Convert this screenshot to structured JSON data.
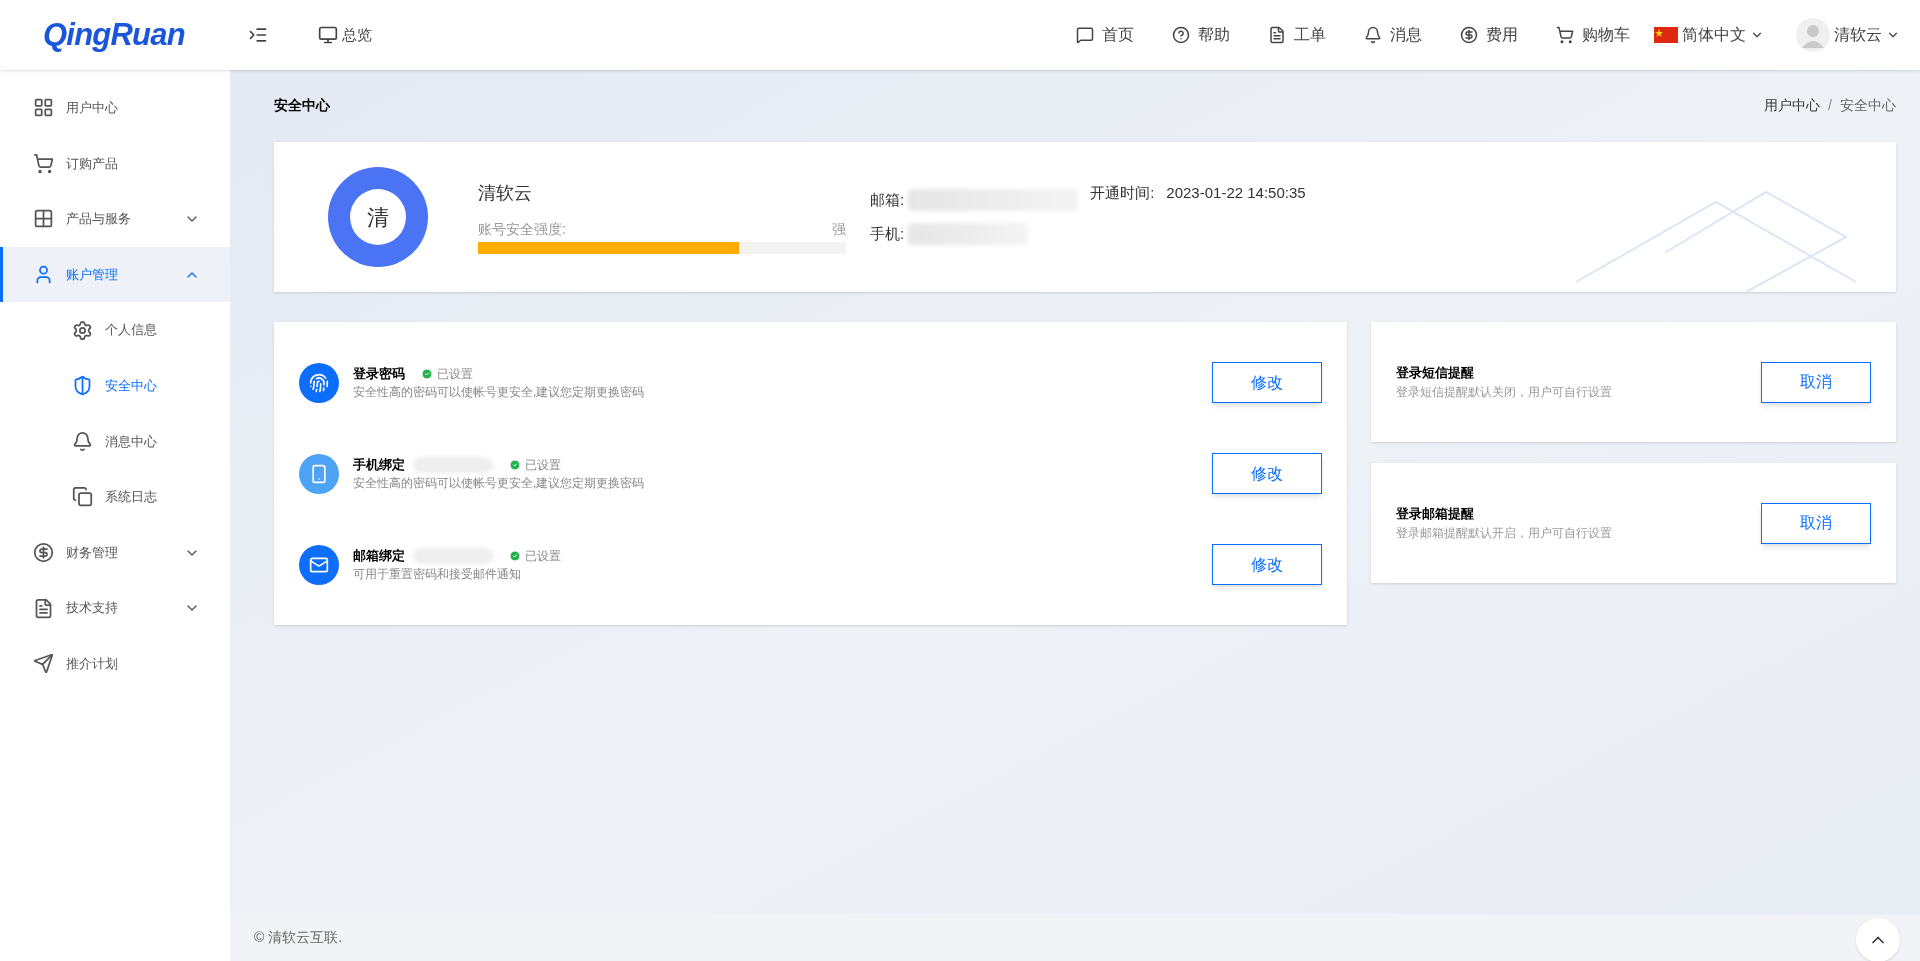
{
  "header": {
    "logo": "QingRuan",
    "overview": "总览",
    "nav": [
      {
        "label": "首页"
      },
      {
        "label": "帮助"
      },
      {
        "label": "工单"
      },
      {
        "label": "消息"
      },
      {
        "label": "费用"
      },
      {
        "label": "购物车"
      }
    ],
    "language": "简体中文",
    "user": "清软云"
  },
  "sidebar": {
    "items": [
      {
        "label": "用户中心",
        "selected": false
      },
      {
        "label": "订购产品",
        "selected": false
      },
      {
        "label": "产品与服务",
        "selected": false,
        "expanded": false
      },
      {
        "label": "账户管理",
        "selected": true,
        "expanded": true,
        "children": [
          {
            "label": "个人信息",
            "selected": false
          },
          {
            "label": "安全中心",
            "selected": true
          },
          {
            "label": "消息中心",
            "selected": false
          },
          {
            "label": "系统日志",
            "selected": false
          }
        ]
      },
      {
        "label": "财务管理",
        "selected": false,
        "expanded": false
      },
      {
        "label": "技术支持",
        "selected": false,
        "expanded": false
      },
      {
        "label": "推介计划",
        "selected": false
      }
    ]
  },
  "page": {
    "title": "安全中心",
    "breadcrumb": [
      "用户中心",
      "安全中心"
    ],
    "breadcrumb_separator": "/"
  },
  "profile": {
    "avatar_text": "清",
    "name": "清软云",
    "strength_label": "账号安全强度:",
    "strength_value": "强",
    "level": 0.71,
    "email_label": "邮箱:",
    "phone_label": "手机:",
    "opened_label": "开通时间:",
    "opened_value": "2023-01-22 14:50:35"
  },
  "security": [
    {
      "title": "登录密码",
      "masked": false,
      "status": "已设置",
      "description": "安全性高的密码可以使帐号更安全,建议您定期更换密码",
      "button": "修改"
    },
    {
      "title": "手机绑定",
      "masked": true,
      "status": "已设置",
      "description": "安全性高的密码可以使帐号更安全,建议您定期更换密码",
      "button": "修改"
    },
    {
      "title": "邮箱绑定",
      "masked": true,
      "status": "已设置",
      "description": "可用于重置密码和接受邮件通知",
      "button": "修改"
    }
  ],
  "alerts": [
    {
      "title": "登录短信提醒",
      "description": "登录短信提醒默认关闭，用户可自行设置",
      "button": "取消"
    },
    {
      "title": "登录邮箱提醒",
      "description": "登录邮箱提醒默认开启，用户可自行设置",
      "button": "取消"
    }
  ],
  "footer": {
    "copyright": "© 清软云互联."
  }
}
